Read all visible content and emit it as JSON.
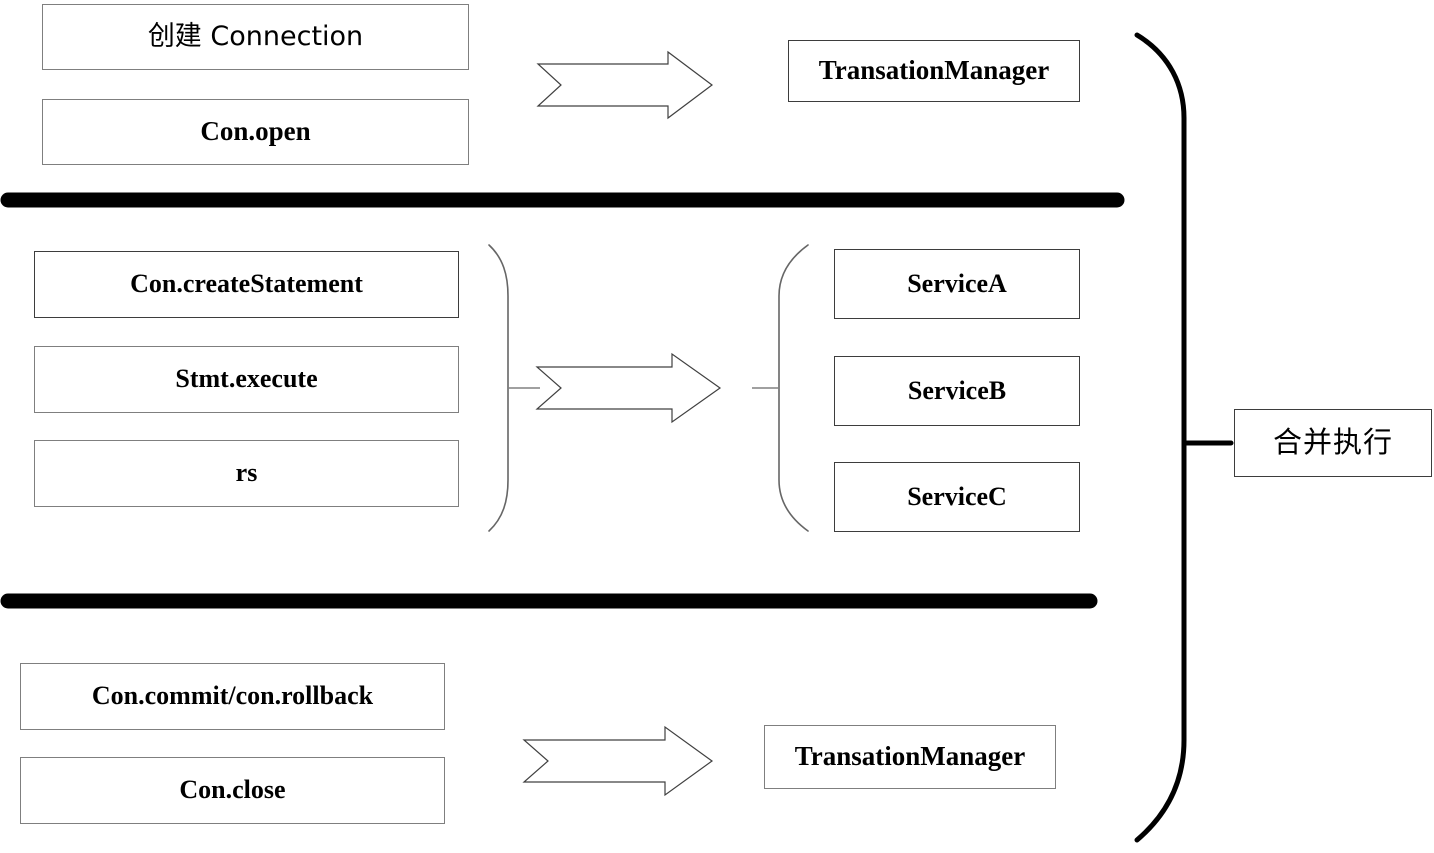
{
  "diagram": {
    "title": "JDBC transaction phases merged into TransationManager",
    "background_color": "#ffffff",
    "box_border_color": "#7f7f7f",
    "separator_color": "#000000",
    "brace_color": "#666666",
    "thick_brace_color": "#000000",
    "arrow_fill": "#ffffff",
    "arrow_stroke": "#404040"
  },
  "sections": {
    "top": {
      "jdbc_steps": [
        {
          "label": "创建 Connection"
        },
        {
          "label": "Con.open"
        }
      ],
      "arrow": {
        "label": "maps-to-arrow"
      },
      "target": {
        "label": "TransationManager"
      }
    },
    "middle": {
      "jdbc_steps": [
        {
          "label": "Con.createStatement"
        },
        {
          "label": "Stmt.execute"
        },
        {
          "label": "rs"
        }
      ],
      "arrow": {
        "label": "maps-to-arrow"
      },
      "services": [
        {
          "label": "ServiceA"
        },
        {
          "label": "ServiceB"
        },
        {
          "label": "ServiceC"
        }
      ]
    },
    "bottom": {
      "jdbc_steps": [
        {
          "label": "Con.commit/con.rollback"
        },
        {
          "label": "Con.close"
        }
      ],
      "arrow": {
        "label": "maps-to-arrow"
      },
      "target": {
        "label": "TransationManager"
      }
    }
  },
  "right_group": {
    "brace": {
      "label": "grouping-brace"
    },
    "annotation": {
      "label": "合并执行"
    }
  },
  "separators": [
    {
      "label": "phase-divider-top"
    },
    {
      "label": "phase-divider-bottom"
    }
  ]
}
